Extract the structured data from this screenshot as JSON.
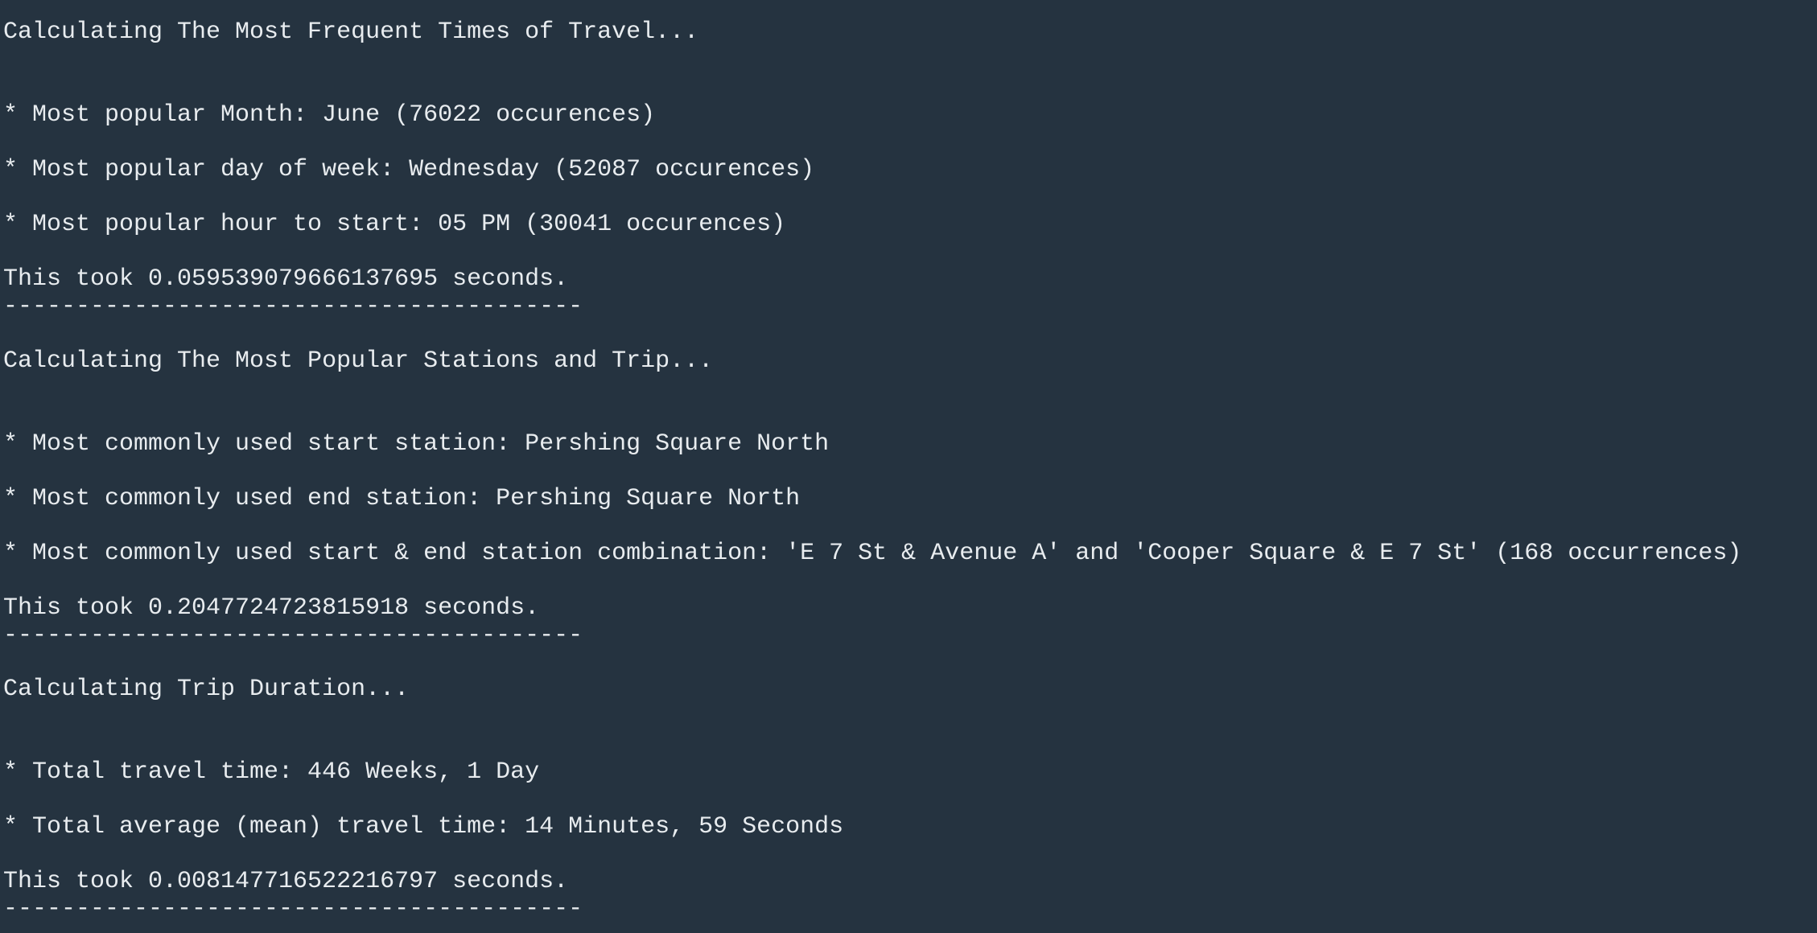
{
  "section1": {
    "heading": "Calculating The Most Frequent Times of Travel...",
    "stat_month": "* Most popular Month: June (76022 occurences)",
    "stat_day": "* Most popular day of week: Wednesday (52087 occurences)",
    "stat_hour": "* Most popular hour to start: 05 PM (30041 occurences)",
    "timing": "This took 0.059539079666137695 seconds.",
    "divider": "----------------------------------------"
  },
  "section2": {
    "heading": "Calculating The Most Popular Stations and Trip...",
    "stat_start": "* Most commonly used start station: Pershing Square North",
    "stat_end": "* Most commonly used end station: Pershing Square North",
    "stat_combo": "* Most commonly used start & end station combination: 'E 7 St & Avenue A' and 'Cooper Square & E 7 St' (168 occurrences)",
    "timing": "This took 0.2047724723815918 seconds.",
    "divider": "----------------------------------------"
  },
  "section3": {
    "heading": "Calculating Trip Duration...",
    "stat_total": "* Total travel time: 446 Weeks, 1 Day",
    "stat_mean": "* Total average (mean) travel time: 14 Minutes, 59 Seconds",
    "timing": "This took 0.008147716522216797 seconds.",
    "divider": "----------------------------------------"
  }
}
